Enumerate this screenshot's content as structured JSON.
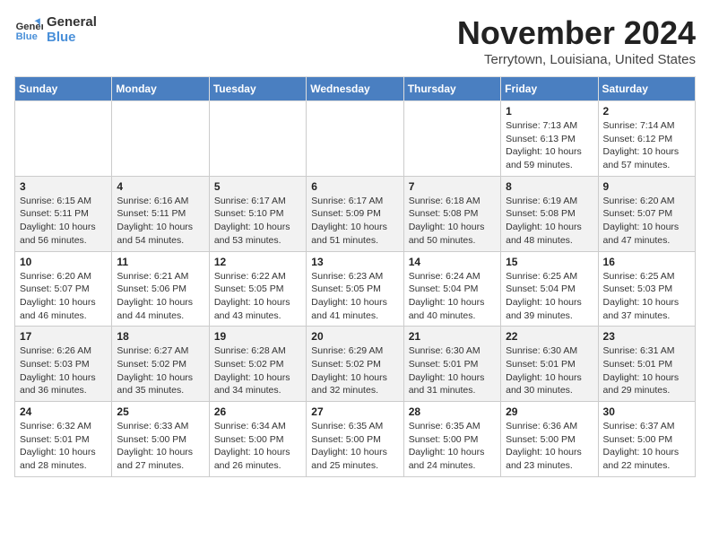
{
  "header": {
    "logo_line1": "General",
    "logo_line2": "Blue",
    "month": "November 2024",
    "location": "Terrytown, Louisiana, United States"
  },
  "weekdays": [
    "Sunday",
    "Monday",
    "Tuesday",
    "Wednesday",
    "Thursday",
    "Friday",
    "Saturday"
  ],
  "weeks": [
    [
      {
        "day": "",
        "info": ""
      },
      {
        "day": "",
        "info": ""
      },
      {
        "day": "",
        "info": ""
      },
      {
        "day": "",
        "info": ""
      },
      {
        "day": "",
        "info": ""
      },
      {
        "day": "1",
        "info": "Sunrise: 7:13 AM\nSunset: 6:13 PM\nDaylight: 10 hours\nand 59 minutes."
      },
      {
        "day": "2",
        "info": "Sunrise: 7:14 AM\nSunset: 6:12 PM\nDaylight: 10 hours\nand 57 minutes."
      }
    ],
    [
      {
        "day": "3",
        "info": "Sunrise: 6:15 AM\nSunset: 5:11 PM\nDaylight: 10 hours\nand 56 minutes."
      },
      {
        "day": "4",
        "info": "Sunrise: 6:16 AM\nSunset: 5:11 PM\nDaylight: 10 hours\nand 54 minutes."
      },
      {
        "day": "5",
        "info": "Sunrise: 6:17 AM\nSunset: 5:10 PM\nDaylight: 10 hours\nand 53 minutes."
      },
      {
        "day": "6",
        "info": "Sunrise: 6:17 AM\nSunset: 5:09 PM\nDaylight: 10 hours\nand 51 minutes."
      },
      {
        "day": "7",
        "info": "Sunrise: 6:18 AM\nSunset: 5:08 PM\nDaylight: 10 hours\nand 50 minutes."
      },
      {
        "day": "8",
        "info": "Sunrise: 6:19 AM\nSunset: 5:08 PM\nDaylight: 10 hours\nand 48 minutes."
      },
      {
        "day": "9",
        "info": "Sunrise: 6:20 AM\nSunset: 5:07 PM\nDaylight: 10 hours\nand 47 minutes."
      }
    ],
    [
      {
        "day": "10",
        "info": "Sunrise: 6:20 AM\nSunset: 5:07 PM\nDaylight: 10 hours\nand 46 minutes."
      },
      {
        "day": "11",
        "info": "Sunrise: 6:21 AM\nSunset: 5:06 PM\nDaylight: 10 hours\nand 44 minutes."
      },
      {
        "day": "12",
        "info": "Sunrise: 6:22 AM\nSunset: 5:05 PM\nDaylight: 10 hours\nand 43 minutes."
      },
      {
        "day": "13",
        "info": "Sunrise: 6:23 AM\nSunset: 5:05 PM\nDaylight: 10 hours\nand 41 minutes."
      },
      {
        "day": "14",
        "info": "Sunrise: 6:24 AM\nSunset: 5:04 PM\nDaylight: 10 hours\nand 40 minutes."
      },
      {
        "day": "15",
        "info": "Sunrise: 6:25 AM\nSunset: 5:04 PM\nDaylight: 10 hours\nand 39 minutes."
      },
      {
        "day": "16",
        "info": "Sunrise: 6:25 AM\nSunset: 5:03 PM\nDaylight: 10 hours\nand 37 minutes."
      }
    ],
    [
      {
        "day": "17",
        "info": "Sunrise: 6:26 AM\nSunset: 5:03 PM\nDaylight: 10 hours\nand 36 minutes."
      },
      {
        "day": "18",
        "info": "Sunrise: 6:27 AM\nSunset: 5:02 PM\nDaylight: 10 hours\nand 35 minutes."
      },
      {
        "day": "19",
        "info": "Sunrise: 6:28 AM\nSunset: 5:02 PM\nDaylight: 10 hours\nand 34 minutes."
      },
      {
        "day": "20",
        "info": "Sunrise: 6:29 AM\nSunset: 5:02 PM\nDaylight: 10 hours\nand 32 minutes."
      },
      {
        "day": "21",
        "info": "Sunrise: 6:30 AM\nSunset: 5:01 PM\nDaylight: 10 hours\nand 31 minutes."
      },
      {
        "day": "22",
        "info": "Sunrise: 6:30 AM\nSunset: 5:01 PM\nDaylight: 10 hours\nand 30 minutes."
      },
      {
        "day": "23",
        "info": "Sunrise: 6:31 AM\nSunset: 5:01 PM\nDaylight: 10 hours\nand 29 minutes."
      }
    ],
    [
      {
        "day": "24",
        "info": "Sunrise: 6:32 AM\nSunset: 5:01 PM\nDaylight: 10 hours\nand 28 minutes."
      },
      {
        "day": "25",
        "info": "Sunrise: 6:33 AM\nSunset: 5:00 PM\nDaylight: 10 hours\nand 27 minutes."
      },
      {
        "day": "26",
        "info": "Sunrise: 6:34 AM\nSunset: 5:00 PM\nDaylight: 10 hours\nand 26 minutes."
      },
      {
        "day": "27",
        "info": "Sunrise: 6:35 AM\nSunset: 5:00 PM\nDaylight: 10 hours\nand 25 minutes."
      },
      {
        "day": "28",
        "info": "Sunrise: 6:35 AM\nSunset: 5:00 PM\nDaylight: 10 hours\nand 24 minutes."
      },
      {
        "day": "29",
        "info": "Sunrise: 6:36 AM\nSunset: 5:00 PM\nDaylight: 10 hours\nand 23 minutes."
      },
      {
        "day": "30",
        "info": "Sunrise: 6:37 AM\nSunset: 5:00 PM\nDaylight: 10 hours\nand 22 minutes."
      }
    ]
  ]
}
